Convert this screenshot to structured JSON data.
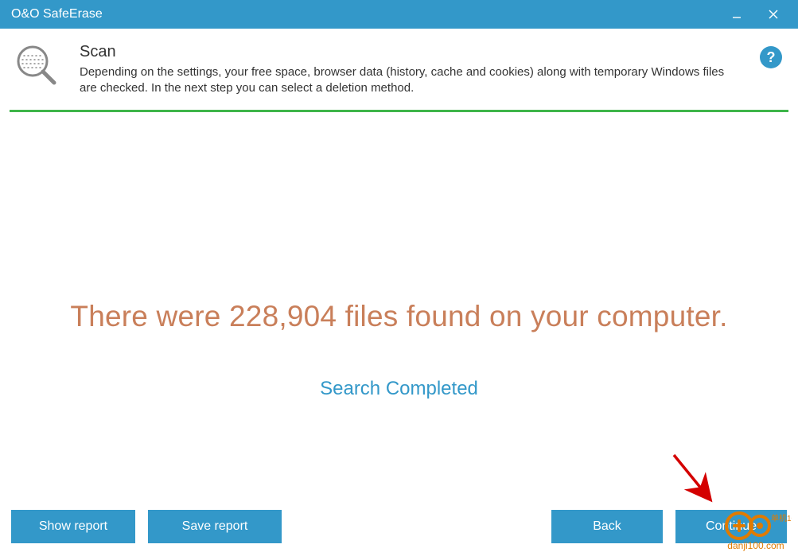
{
  "window": {
    "title": "O&O SafeErase"
  },
  "header": {
    "title": "Scan",
    "description": "Depending on the settings, your free space, browser data (history, cache and cookies) along with temporary Windows files are checked. In the next step you can select a deletion method.",
    "help_tooltip": "?"
  },
  "result": {
    "line": "There were 228,904 files found on your computer.",
    "status": "Search Completed"
  },
  "buttons": {
    "show_report": "Show report",
    "save_report": "Save report",
    "back": "Back",
    "continue": "Continue"
  },
  "watermark": {
    "url": "danji100.com"
  }
}
